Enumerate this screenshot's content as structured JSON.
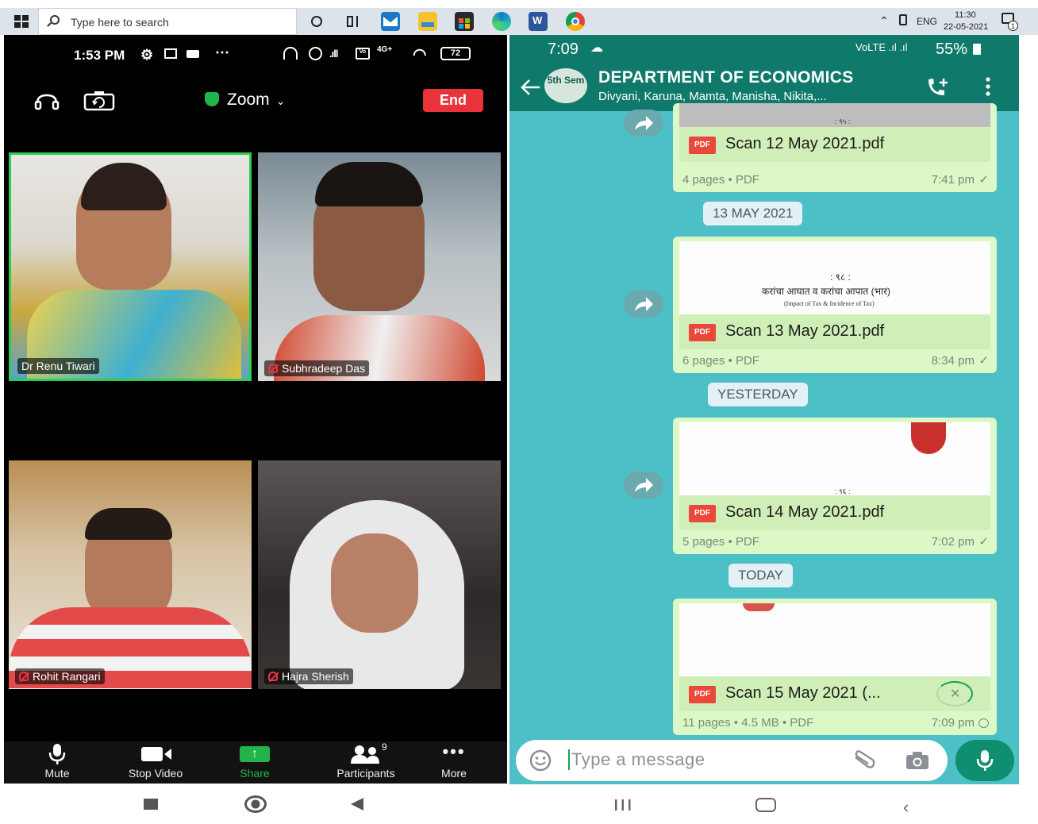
{
  "taskbar": {
    "search_placeholder": "Type here to search",
    "language": "ENG",
    "clock_time": "11:30",
    "clock_date": "22-05-2021",
    "notification_count": "1"
  },
  "zoom": {
    "status_time": "1:53 PM",
    "battery": "72",
    "title": "Zoom",
    "end_label": "End",
    "participants": [
      {
        "name": "Dr Renu Tiwari",
        "muted": false,
        "active": true
      },
      {
        "name": "Subhradeep Das",
        "muted": true,
        "active": false
      },
      {
        "name": "Rohit Rangari",
        "muted": true,
        "active": false
      },
      {
        "name": "Hajra Sherish",
        "muted": true,
        "active": false
      }
    ],
    "toolbar": {
      "mute": "Mute",
      "stop_video": "Stop Video",
      "share": "Share",
      "participants": "Participants",
      "participants_count": "9",
      "more": "More"
    }
  },
  "whatsapp": {
    "status_time": "7:09",
    "battery": "55%",
    "group_avatar": "5th Sem",
    "group_name": "DEPARTMENT OF ECONOMICS",
    "members": "Divyani, Karuna, Mamta, Manisha, Nikita,...",
    "messages": [
      {
        "file": "Scan 12 May 2021.pdf",
        "meta": "4 pages • PDF",
        "time": "7:41 pm",
        "thumb_text": ": ९५ :"
      },
      {
        "date": "13 MAY 2021"
      },
      {
        "file": "Scan 13 May 2021.pdf",
        "meta": "6 pages • PDF",
        "time": "8:34 pm",
        "thumb_text": ": ९८ :",
        "thumb_line1": "करांचा आघात व करांचा आपात (भार)",
        "thumb_line2": "(Impact of Tax & Incidence of Tax)"
      },
      {
        "date": "YESTERDAY"
      },
      {
        "file": "Scan 14 May 2021.pdf",
        "meta": "5 pages • PDF",
        "time": "7:02 pm",
        "thumb_text": ": ९६ :"
      },
      {
        "date": "TODAY"
      },
      {
        "file": "Scan 15 May 2021 (...",
        "meta": "11 pages • 4.5 MB • PDF",
        "time": "7:09 pm"
      }
    ],
    "input_placeholder": "Type a message"
  },
  "colors": {
    "zoom_end": "#e8333a",
    "zoom_share": "#22b34a",
    "active_speaker": "#2ecc55",
    "wa_header": "#0f7a6b",
    "wa_chat_bg": "#4cbfc7",
    "wa_bubble": "#dcf8c6"
  }
}
